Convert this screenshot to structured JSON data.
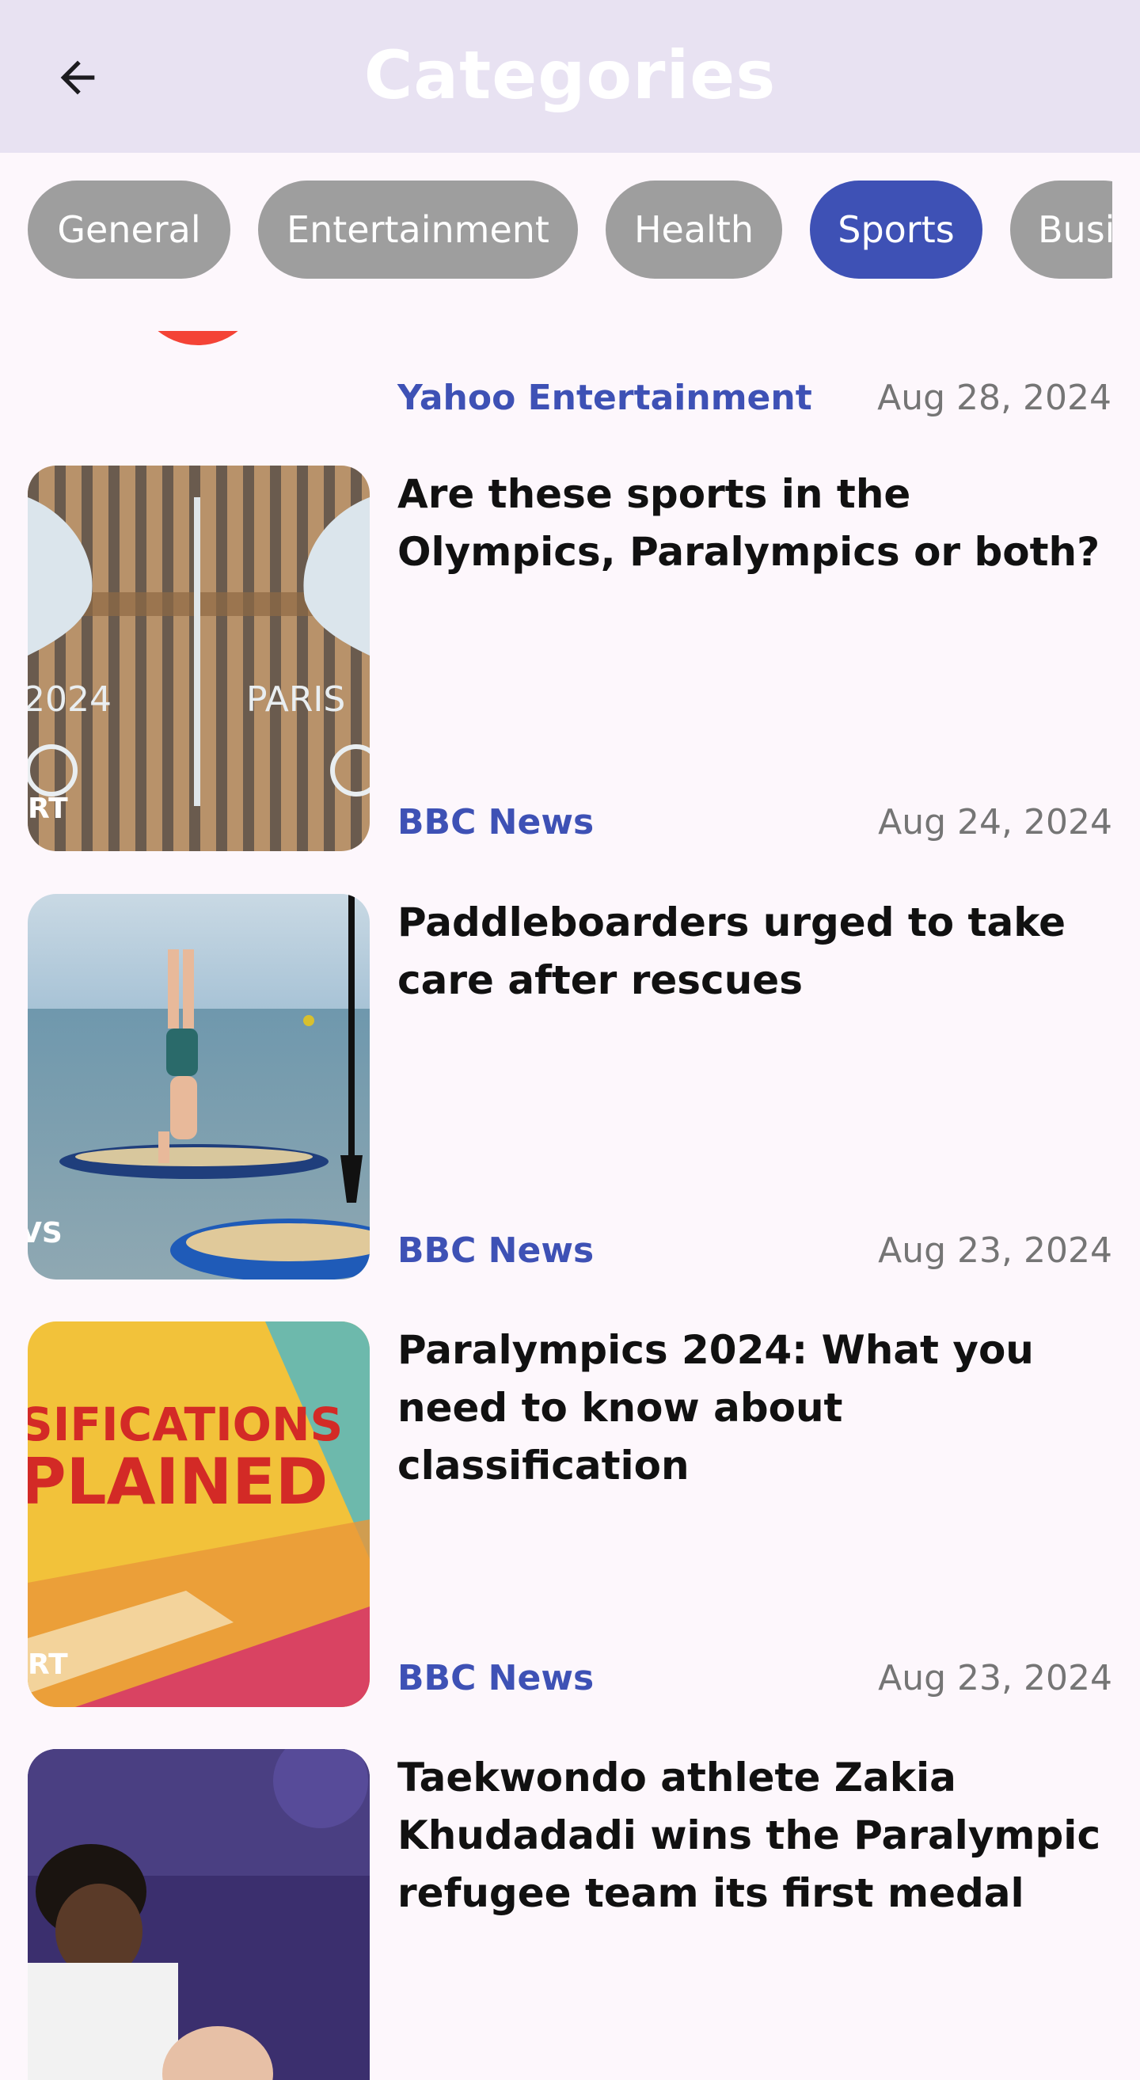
{
  "app_bar": {
    "title": "Categories",
    "back_icon": "arrow-left-icon"
  },
  "categories": {
    "chips": [
      {
        "label": "General",
        "selected": false
      },
      {
        "label": "Entertainment",
        "selected": false
      },
      {
        "label": "Health",
        "selected": false
      },
      {
        "label": "Sports",
        "selected": true
      },
      {
        "label": "Busi",
        "selected": false
      }
    ],
    "selected_color": "#3e51b5",
    "unselected_color": "#9e9e9e"
  },
  "articles": {
    "partial": {
      "source": "Yahoo Entertainment",
      "date": "Aug 28, 2024"
    },
    "items": [
      {
        "headline": "Are these sports in the Olympics, Paralympics or both?",
        "source": "BBC News",
        "date": "Aug 24, 2024",
        "thumbnail_text": "RT"
      },
      {
        "headline": "Paddleboarders urged to take care after rescues",
        "source": "BBC News",
        "date": "Aug 23, 2024",
        "thumbnail_text": "VS"
      },
      {
        "headline": "Paralympics 2024: What you need to know about classification",
        "source": "BBC News",
        "date": "Aug 23, 2024",
        "thumbnail_text": "RT"
      },
      {
        "headline": "Taekwondo athlete Zakia Khudadadi wins the Paralympic refugee team its first medal",
        "source": "",
        "date": "",
        "thumbnail_text": ""
      }
    ]
  },
  "thumbnail_art": {
    "olympics_sign": [
      "2024",
      "PARIS"
    ],
    "classification_poster": [
      "SIFICATIONS",
      "PLAINED"
    ]
  },
  "colors": {
    "app_bar_bg": "#e8e2f2",
    "page_bg": "#fdf7fc",
    "source_text": "#3e51b5",
    "date_text": "#757575"
  }
}
